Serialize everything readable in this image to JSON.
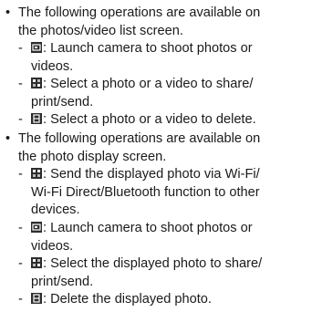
{
  "bullet_char": "•",
  "dash_char": "-",
  "sections": [
    {
      "intro_line1": "The following operations are available on",
      "intro_line2": "the photos/video list screen.",
      "items": [
        {
          "icon": "camera-icon",
          "line1": ": Launch camera to shoot photos or",
          "line2": "videos."
        },
        {
          "icon": "share-icon",
          "line1": ": Select a photo or a video to share/",
          "line2": "print/send."
        },
        {
          "icon": "delete-icon",
          "line1": ": Select a photo or a video to delete."
        }
      ]
    },
    {
      "intro_line1": "The following operations are available on",
      "intro_line2": "the photo display screen.",
      "items": [
        {
          "icon": "wireless-send-icon",
          "line1": ": Send the displayed photo via Wi-Fi/",
          "line2": "Wi-Fi Direct/Bluetooth function to other",
          "line3": "devices."
        },
        {
          "icon": "camera-icon",
          "line1": ": Launch camera to shoot photos or",
          "line2": "videos."
        },
        {
          "icon": "share-icon",
          "line1": ": Select the displayed photo to share/",
          "line2": "print/send."
        },
        {
          "icon": "delete-icon",
          "line1": ": Delete the displayed photo."
        }
      ]
    }
  ]
}
